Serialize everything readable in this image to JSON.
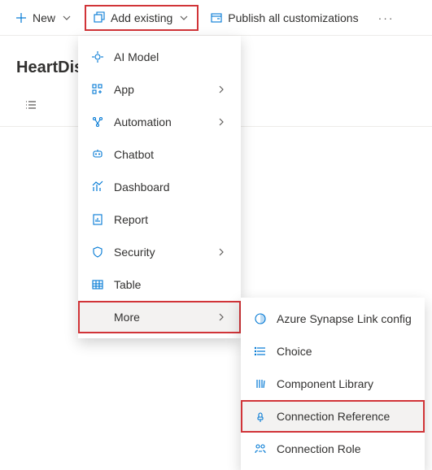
{
  "toolbar": {
    "new_label": "New",
    "add_existing_label": "Add existing",
    "publish_label": "Publish all customizations"
  },
  "page": {
    "title_partial": "HeartDise"
  },
  "menu": {
    "items": [
      {
        "icon": "ai-model-icon",
        "label": "AI Model",
        "has_sub": false
      },
      {
        "icon": "app-icon",
        "label": "App",
        "has_sub": true
      },
      {
        "icon": "automation-icon",
        "label": "Automation",
        "has_sub": true
      },
      {
        "icon": "chatbot-icon",
        "label": "Chatbot",
        "has_sub": false
      },
      {
        "icon": "dashboard-icon",
        "label": "Dashboard",
        "has_sub": false
      },
      {
        "icon": "report-icon",
        "label": "Report",
        "has_sub": false
      },
      {
        "icon": "security-icon",
        "label": "Security",
        "has_sub": true
      },
      {
        "icon": "table-icon",
        "label": "Table",
        "has_sub": false
      },
      {
        "icon": "more-icon",
        "label": "More",
        "has_sub": true
      }
    ]
  },
  "submenu": {
    "items": [
      {
        "icon": "synapse-icon",
        "label": "Azure Synapse Link config"
      },
      {
        "icon": "choice-icon",
        "label": "Choice"
      },
      {
        "icon": "component-library-icon",
        "label": "Component Library"
      },
      {
        "icon": "connection-reference-icon",
        "label": "Connection Reference"
      },
      {
        "icon": "connection-role-icon",
        "label": "Connection Role"
      }
    ]
  }
}
